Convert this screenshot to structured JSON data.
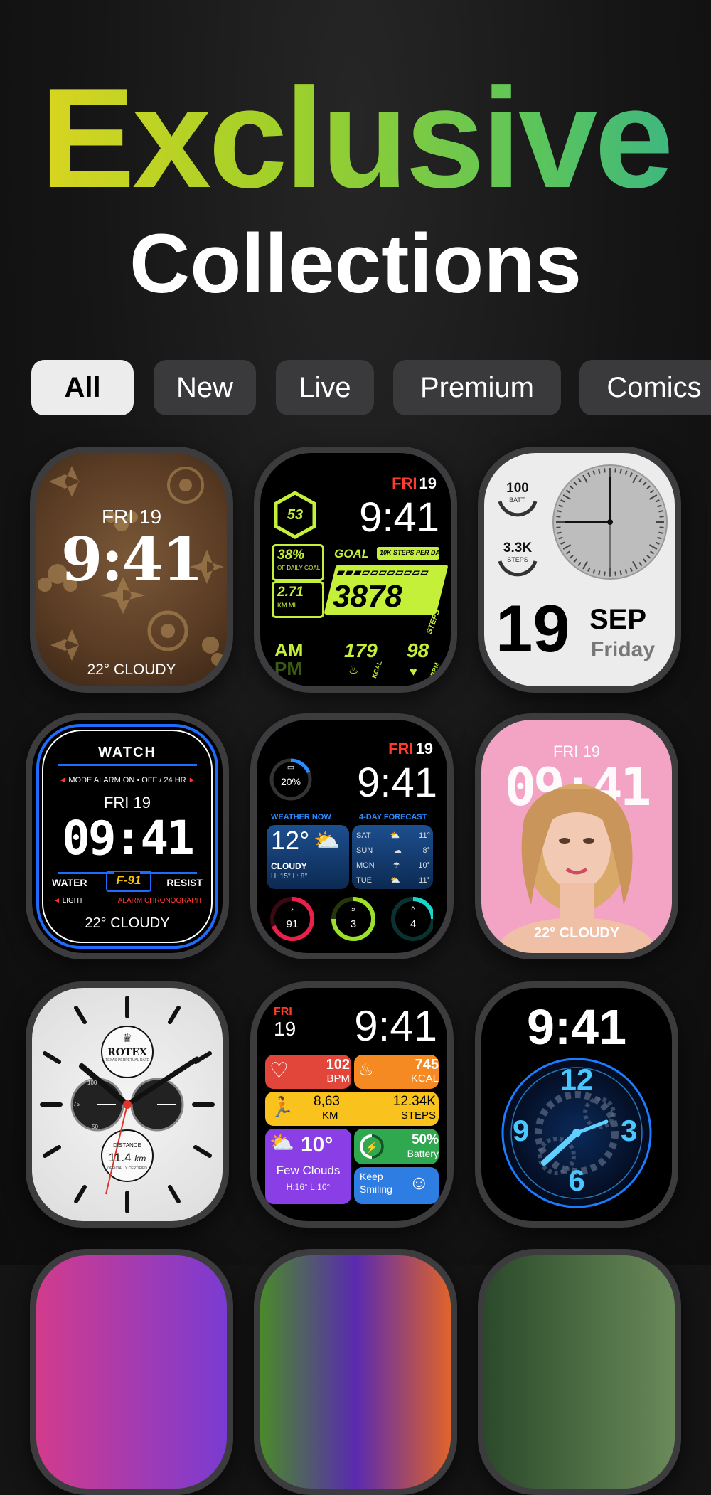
{
  "heading": {
    "line1": "Exclusive",
    "line2": "Collections"
  },
  "filters": [
    {
      "label": "All",
      "active": true
    },
    {
      "label": "New"
    },
    {
      "label": "Live"
    },
    {
      "label": "Premium"
    },
    {
      "label": "Comics"
    }
  ],
  "watches": {
    "w1": {
      "day": "FRI 19",
      "time": "9:41",
      "weather": "22° CLOUDY"
    },
    "w2": {
      "day": "FRI",
      "date": "19",
      "time": "9:41",
      "ring": "53",
      "pct": "38%",
      "pct_label": "OF DAILY GOAL",
      "goal": "GOAL",
      "goal_sub": "10K STEPS PER DAY",
      "km": "2.71",
      "km_unit": "KM MI",
      "steps": "3878",
      "steps_label": "STEPS",
      "am": "AM",
      "pm": "PM",
      "kcal": "179",
      "kcal_label": "KCAL",
      "bpm": "98",
      "bpm_label": "BPM"
    },
    "w3": {
      "batt": "100",
      "batt_label": "BATT.",
      "steps": "3.3K",
      "steps_label": "STEPS",
      "date": "19",
      "month": "SEP",
      "weekday": "Friday"
    },
    "w4": {
      "brand": "WATCH",
      "mode": "MODE   ALARM ON • OFF / 24 HR",
      "day": "FRI 19",
      "time": "09:41",
      "water": "WATER",
      "model": "F-91",
      "resist": "RESIST",
      "light": "LIGHT",
      "chrono": "ALARM CHRONOGRAPH",
      "weather": "22° CLOUDY"
    },
    "w5": {
      "day": "FRI",
      "date": "19",
      "time": "9:41",
      "battery": "20%",
      "weather_now": "WEATHER NOW",
      "forecast_title": "4-DAY FORECAST",
      "temp": "12°",
      "condition": "CLOUDY",
      "hilo": "H: 15°  L: 8°",
      "forecast": [
        {
          "day": "SAT",
          "t": "11°"
        },
        {
          "day": "SUN",
          "t": "8°"
        },
        {
          "day": "MON",
          "t": "10°"
        },
        {
          "day": "TUE",
          "t": "11°"
        }
      ],
      "rings": [
        {
          "v": "91",
          "color": "#e8204a"
        },
        {
          "v": "3",
          "color": "#9be02a"
        },
        {
          "v": "4",
          "color": "#19d6c8"
        }
      ]
    },
    "w6": {
      "day": "FRI 19",
      "time": "09:41",
      "weather": "22° CLOUDY"
    },
    "w7": {
      "brand": "ROTEX",
      "brand_sub": "TEXAS PERPETUAL DATE",
      "distance_label": "DISTANCE",
      "distance": "11.4",
      "distance_unit": "km",
      "certified": "OFFICIALLY CERTIFIED",
      "sub1": "100",
      "sub2": "50",
      "sub3": "75"
    },
    "w8": {
      "day": "FRI",
      "date": "19",
      "time": "9:41",
      "bpm": "102",
      "bpm_label": "BPM",
      "kcal": "745",
      "kcal_label": "KCAL",
      "km": "8,63",
      "km_label": "KM",
      "steps": "12.34K",
      "steps_label": "STEPS",
      "temp": "10°",
      "condition": "Few Clouds",
      "hilo": "H:16°  L:10°",
      "battery": "50%",
      "battery_label": "Battery",
      "keep": "Keep",
      "smiling": "Smiling"
    },
    "w9": {
      "time": "9:41",
      "n12": "12",
      "n3": "3",
      "n6": "6",
      "n9": "9"
    }
  },
  "colors": {
    "accent_red": "#ff3b30",
    "lime": "#c5f03a",
    "pink": "#f3a3c4"
  }
}
